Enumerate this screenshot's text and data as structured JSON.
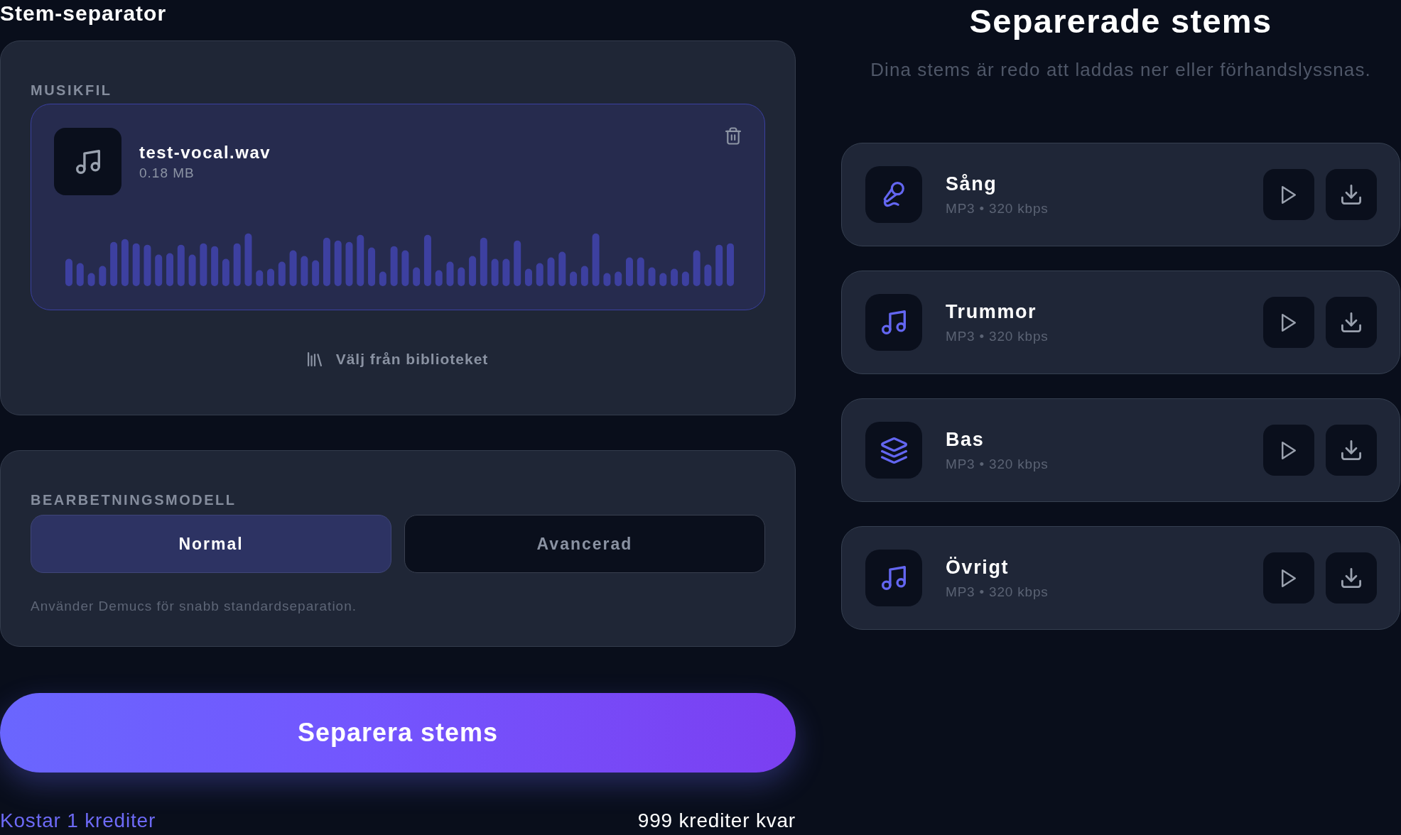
{
  "app": {
    "title": "Stem-separator"
  },
  "music_file": {
    "label": "MUSIKFIL",
    "file": {
      "name": "test-vocal.wav",
      "size": "0.18 MB"
    },
    "library_button": "Välj från biblioteket"
  },
  "processing_model": {
    "label": "BEARBETNINGSMODELL",
    "options": [
      {
        "label": "Normal",
        "selected": true
      },
      {
        "label": "Avancerad",
        "selected": false
      }
    ],
    "description": "Använder Demucs för snabb standardseparation."
  },
  "primary_button": "Separera stems",
  "footer": {
    "cost": "Kostar 1 krediter",
    "balance": "999 krediter kvar"
  },
  "results": {
    "title": "Separerade stems",
    "subtitle": "Dina stems är redo att laddas ner eller förhandslyssnas.",
    "stems": [
      {
        "name": "Sång",
        "format": "MP3 • 320 kbps",
        "kind": "vocals"
      },
      {
        "name": "Trummor",
        "format": "MP3 • 320 kbps",
        "kind": "drums"
      },
      {
        "name": "Bas",
        "format": "MP3 • 320 kbps",
        "kind": "bass"
      },
      {
        "name": "Övrigt",
        "format": "MP3 • 320 kbps",
        "kind": "other"
      }
    ]
  }
}
